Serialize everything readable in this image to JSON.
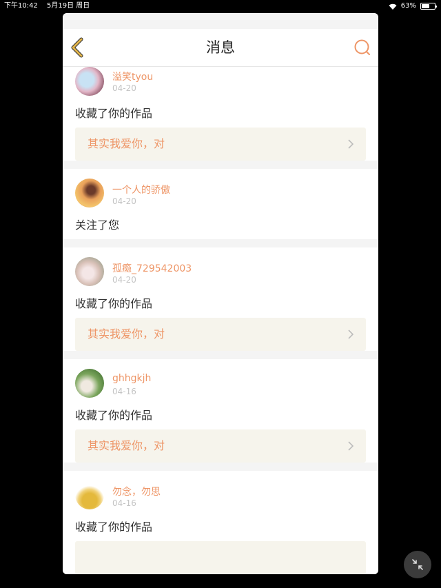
{
  "status_bar": {
    "time": "下午10:42",
    "date": "5月19日 周日",
    "battery": "63%",
    "battery_level": 0.63
  },
  "nav": {
    "title": "消息"
  },
  "items": [
    {
      "user": "溢笑tyou",
      "date": "04-20",
      "action": "收藏了你的作品",
      "work": "其实我爱你，对"
    },
    {
      "user": "一个人的骄傲",
      "date": "04-20",
      "action": "关注了您"
    },
    {
      "user": "孤瘾_729542003",
      "date": "04-20",
      "action": "收藏了你的作品",
      "work": "其实我爱你，对"
    },
    {
      "user": "ghhgkjh",
      "date": "04-16",
      "action": "收藏了你的作品",
      "work": "其实我爱你，对"
    },
    {
      "user": "勿念，勿思",
      "date": "04-16",
      "action": "收藏了你的作品",
      "work": ""
    }
  ],
  "colors": {
    "accent": "#ee9566",
    "back_icon": "#e0b34a",
    "work_bg": "#f6f4ec"
  },
  "icons": {
    "back": "chevron-left-icon",
    "search": "search-icon",
    "fab": "minimize-icon"
  }
}
